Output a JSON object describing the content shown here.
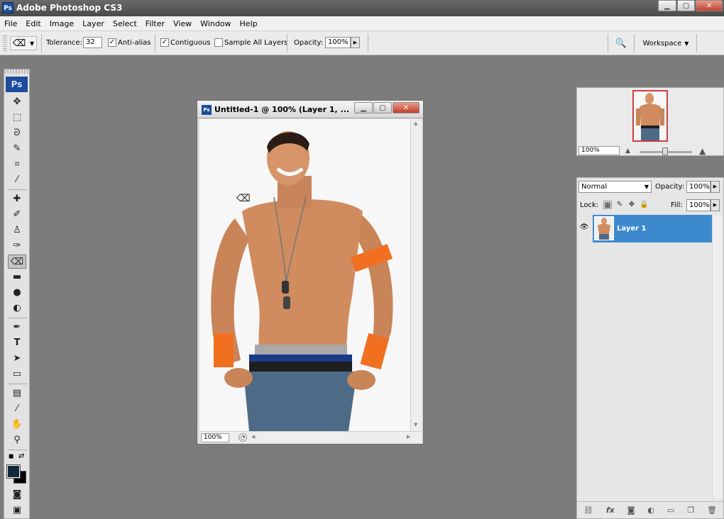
{
  "window": {
    "title": "Adobe Photoshop CS3",
    "app_icon": "Ps",
    "controls": [
      "minimize-icon",
      "maximize-icon",
      "close-icon"
    ]
  },
  "menu": [
    "File",
    "Edit",
    "Image",
    "Layer",
    "Select",
    "Filter",
    "View",
    "Window",
    "Help"
  ],
  "options_bar": {
    "tool_icon": "eraser-icon",
    "tolerance_label": "Tolerance:",
    "tolerance_value": "32",
    "antialias_label": "Anti-alias",
    "antialias_checked": true,
    "contiguous_label": "Contiguous",
    "contiguous_checked": true,
    "sample_all_label": "Sample All Layers",
    "sample_all_checked": false,
    "opacity_label": "Opacity:",
    "opacity_value": "100%",
    "workspace_label": "Workspace"
  },
  "toolbox": {
    "logo": "Ps",
    "tools": [
      "move-tool-icon",
      "marquee-tool-icon",
      "lasso-tool-icon",
      "quick-selection-tool-icon",
      "crop-tool-icon",
      "slice-tool-icon",
      "healing-brush-icon",
      "brush-tool-icon",
      "clone-stamp-icon",
      "history-brush-icon",
      "eraser-tool-icon",
      "gradient-tool-icon",
      "blur-tool-icon",
      "dodge-tool-icon",
      "pen-tool-icon",
      "type-tool-icon",
      "path-selection-icon",
      "shape-tool-icon",
      "notes-tool-icon",
      "eyedropper-tool-icon",
      "hand-tool-icon",
      "zoom-tool-icon"
    ],
    "selected_tool": "eraser-tool-icon",
    "foreground_color": "#0f2a3a",
    "background_color": "#000000"
  },
  "document": {
    "title": "Untitled-1 @ 100% (Layer 1, ...",
    "zoom": "100%"
  },
  "navigator": {
    "zoom": "100%"
  },
  "layers": {
    "blend_mode": "Normal",
    "opacity_label": "Opacity:",
    "opacity_value": "100%",
    "lock_label": "Lock:",
    "fill_label": "Fill:",
    "fill_value": "100%",
    "items": [
      {
        "name": "Layer 1",
        "visible": true,
        "selected": true
      }
    ]
  },
  "colors": {
    "workspace_bg": "#7c7c7c",
    "selection": "#3c8acd",
    "ps_blue": "#1d4d9a"
  }
}
